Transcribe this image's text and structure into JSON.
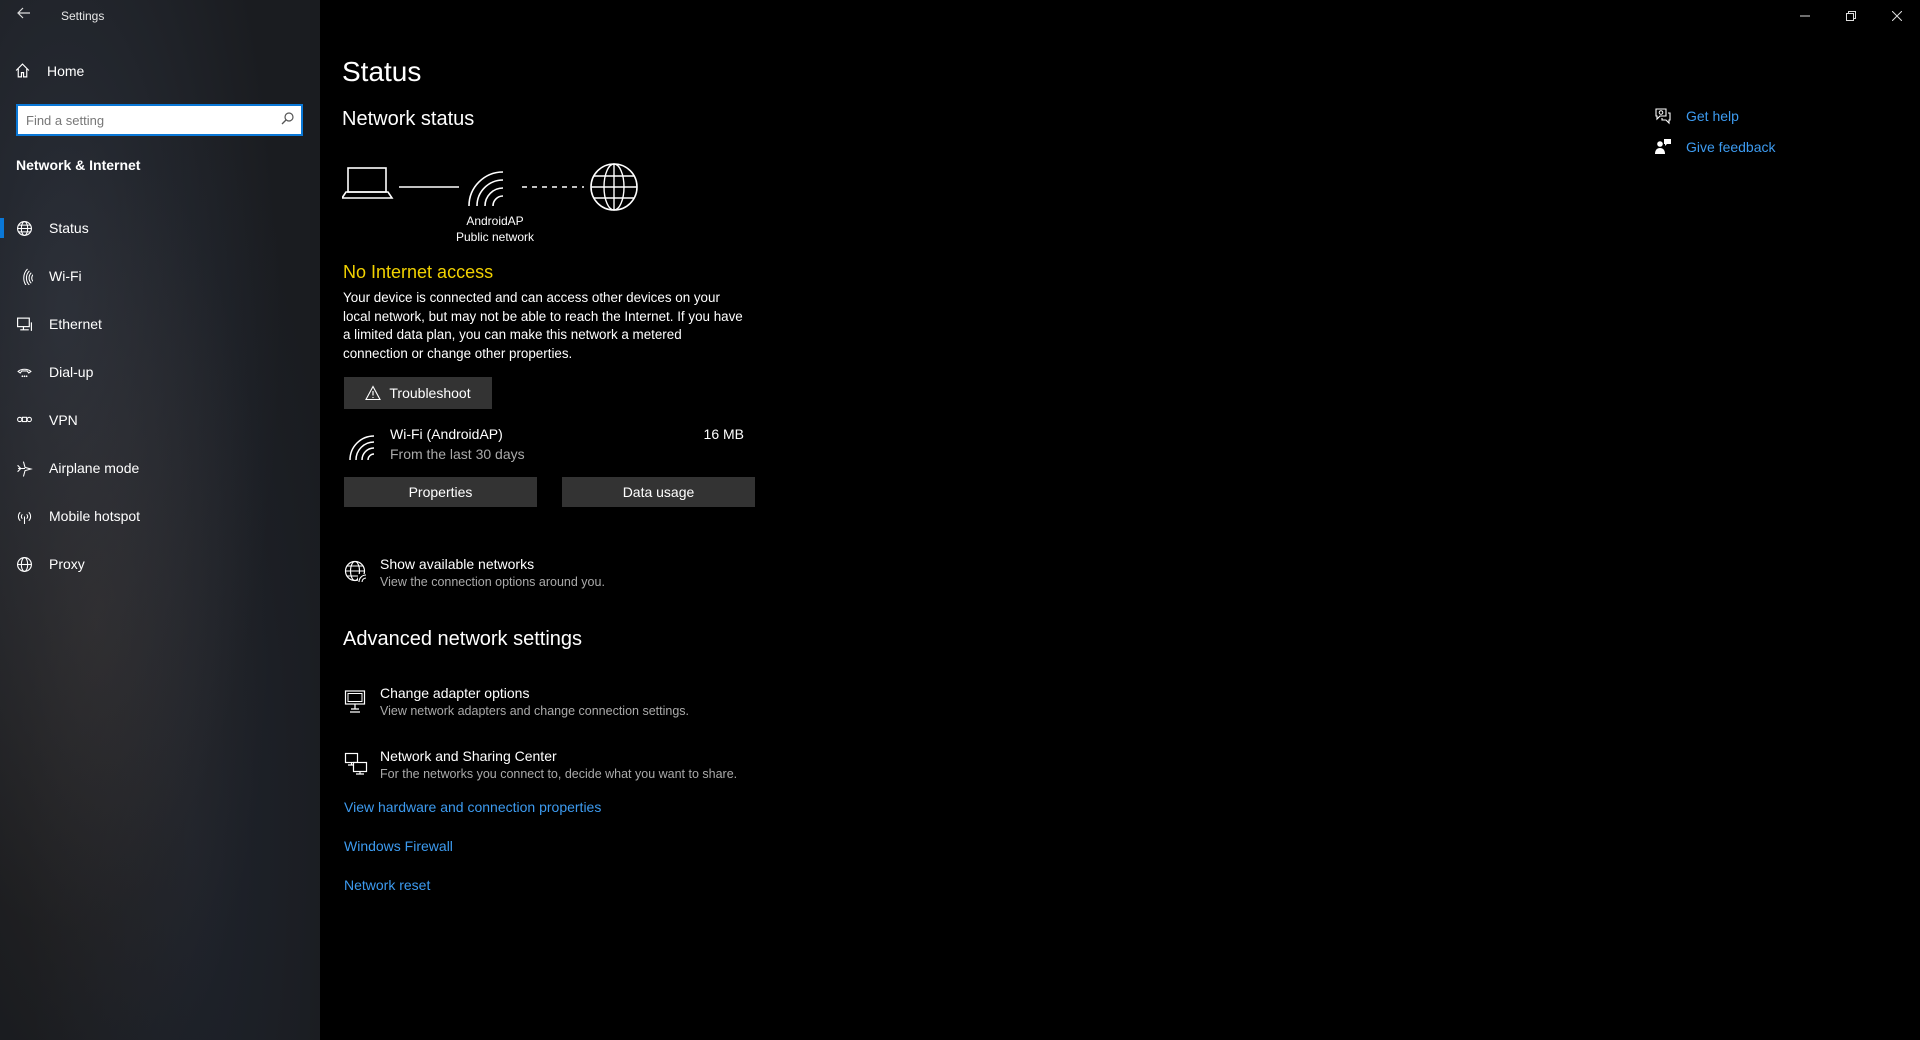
{
  "app": {
    "title": "Settings"
  },
  "sidebar": {
    "home_label": "Home",
    "search": {
      "placeholder": "Find a setting",
      "value": ""
    },
    "section_label": "Network & Internet",
    "items": [
      {
        "label": "Status",
        "icon": "globe-status-icon",
        "active": true
      },
      {
        "label": "Wi-Fi",
        "icon": "wifi-icon",
        "active": false
      },
      {
        "label": "Ethernet",
        "icon": "ethernet-icon",
        "active": false
      },
      {
        "label": "Dial-up",
        "icon": "dialup-icon",
        "active": false
      },
      {
        "label": "VPN",
        "icon": "vpn-icon",
        "active": false
      },
      {
        "label": "Airplane mode",
        "icon": "airplane-icon",
        "active": false
      },
      {
        "label": "Mobile hotspot",
        "icon": "hotspot-icon",
        "active": false
      },
      {
        "label": "Proxy",
        "icon": "globe-icon",
        "active": false
      }
    ]
  },
  "main": {
    "page_title": "Status",
    "network_status_heading": "Network status",
    "diagram": {
      "network_name": "AndroidAP",
      "network_type": "Public network"
    },
    "status_text": "No Internet access",
    "description": "Your device is connected and can access other devices on your local network, but may not be able to reach the Internet. If you have a limited data plan, you can make this network a metered connection or change other properties.",
    "troubleshoot_label": "Troubleshoot",
    "connection": {
      "name": "Wi-Fi (AndroidAP)",
      "subtitle": "From the last 30 days",
      "usage": "16 MB"
    },
    "properties_label": "Properties",
    "data_usage_label": "Data usage",
    "show_networks": {
      "title": "Show available networks",
      "subtitle": "View the connection options around you."
    },
    "advanced_heading": "Advanced network settings",
    "adapter_options": {
      "title": "Change adapter options",
      "subtitle": "View network adapters and change connection settings."
    },
    "sharing_center": {
      "title": "Network and Sharing Center",
      "subtitle": "For the networks you connect to, decide what you want to share."
    },
    "links": {
      "hardware": "View hardware and connection properties",
      "firewall": "Windows Firewall",
      "reset": "Network reset"
    }
  },
  "help": {
    "get_help": "Get help",
    "give_feedback": "Give feedback"
  },
  "colors": {
    "accent": "#0a78d7",
    "link": "#3d9bf0",
    "warning": "#f2d200"
  }
}
